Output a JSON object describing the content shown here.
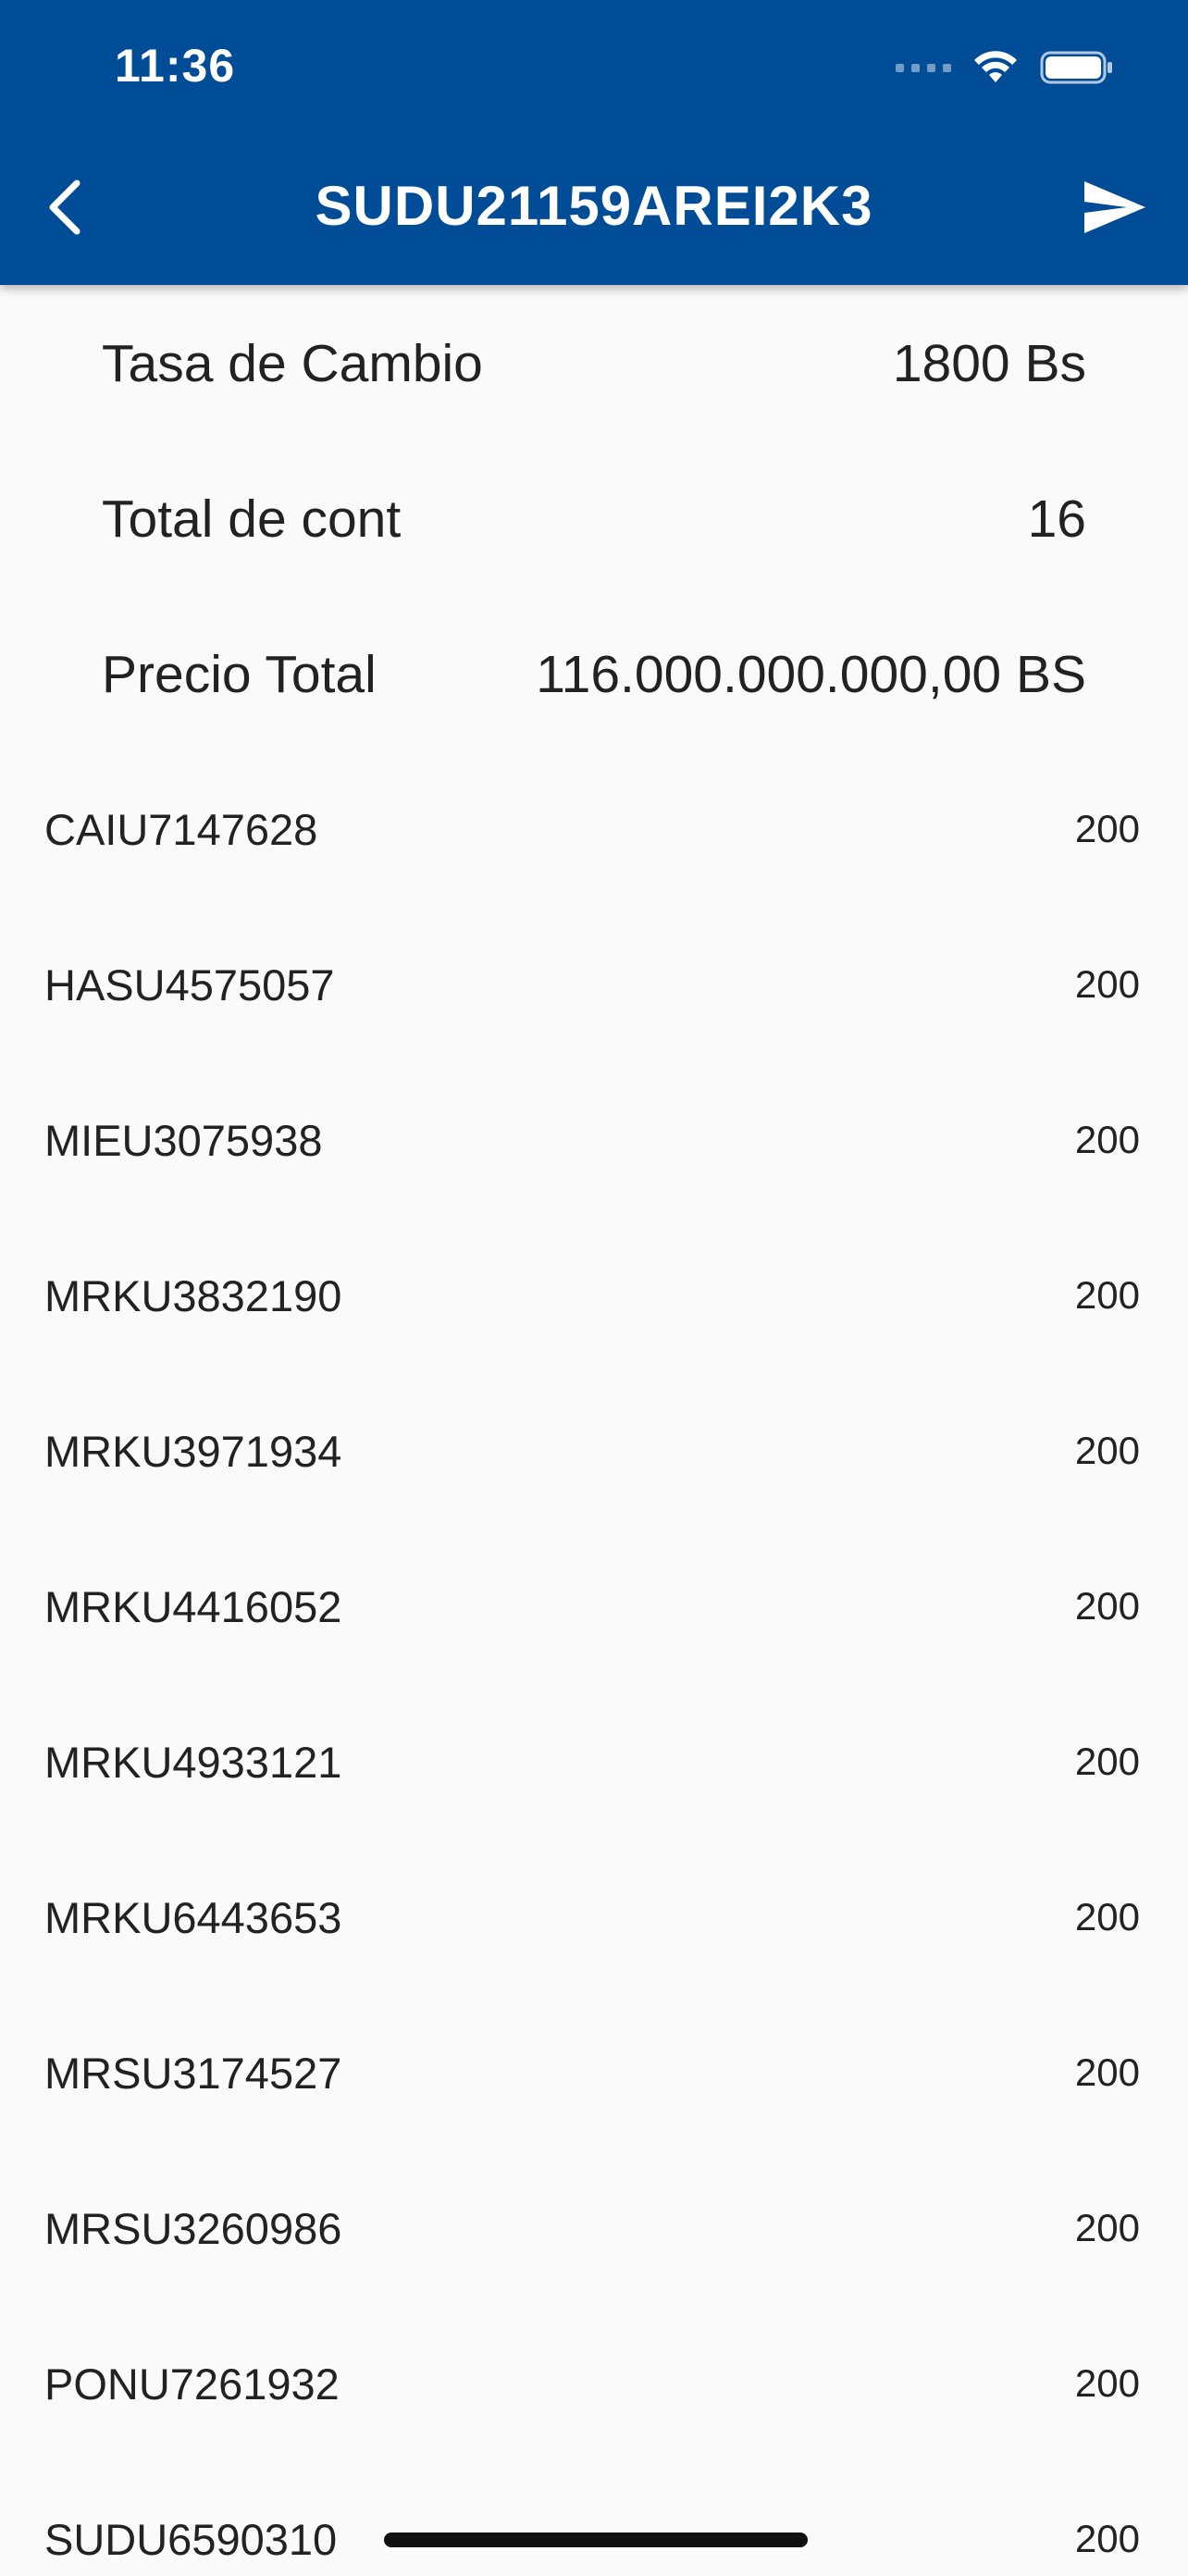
{
  "status_bar": {
    "time": "11:36"
  },
  "header": {
    "title": "SUDU21159AREI2K3"
  },
  "summary": [
    {
      "label": "Tasa de Cambio",
      "value": "1800 Bs"
    },
    {
      "label": "Total de cont",
      "value": "16"
    },
    {
      "label": "Precio Total",
      "value": "116.000.000.000,00 BS"
    }
  ],
  "containers": [
    {
      "code": "CAIU7147628",
      "value": "200"
    },
    {
      "code": "HASU4575057",
      "value": "200"
    },
    {
      "code": "MIEU3075938",
      "value": "200"
    },
    {
      "code": "MRKU3832190",
      "value": "200"
    },
    {
      "code": "MRKU3971934",
      "value": "200"
    },
    {
      "code": "MRKU4416052",
      "value": "200"
    },
    {
      "code": "MRKU4933121",
      "value": "200"
    },
    {
      "code": "MRKU6443653",
      "value": "200"
    },
    {
      "code": "MRSU3174527",
      "value": "200"
    },
    {
      "code": "MRSU3260986",
      "value": "200"
    },
    {
      "code": "PONU7261932",
      "value": "200"
    },
    {
      "code": "SUDU6590310",
      "value": "200"
    }
  ],
  "colors": {
    "appbar": "#004c97",
    "background": "#fafafa",
    "text": "#222222"
  }
}
